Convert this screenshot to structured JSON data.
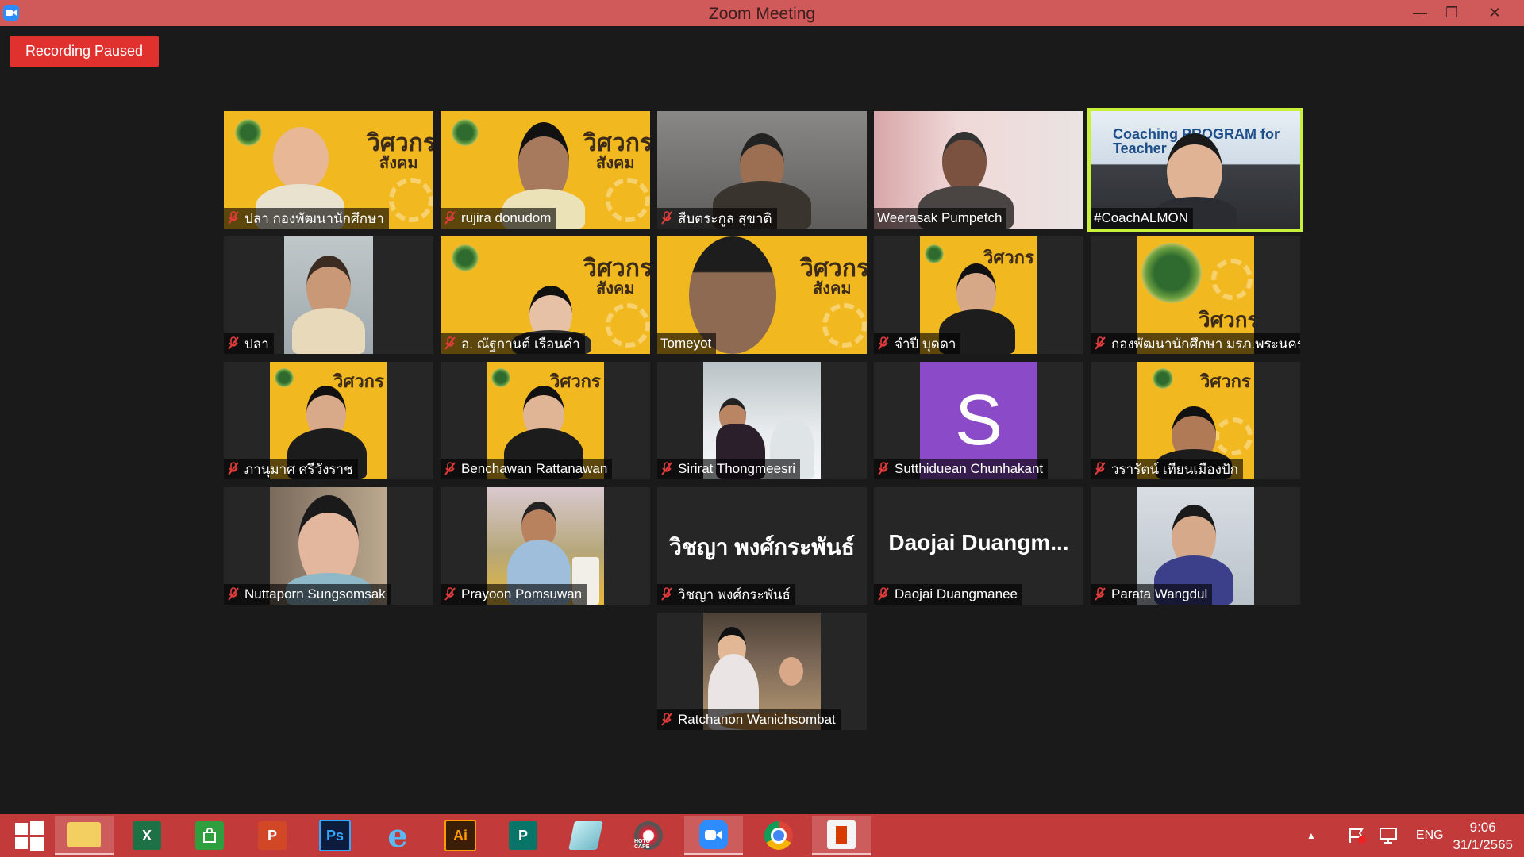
{
  "window": {
    "title": "Zoom Meeting",
    "minimize": "—",
    "restore": "❐",
    "close": "✕"
  },
  "recording": {
    "label": "Recording Paused"
  },
  "participants": [
    {
      "name": "ปลา กองพัฒนานักศึกษา",
      "muted": true,
      "active": false
    },
    {
      "name": "rujira donudom",
      "muted": true,
      "active": false
    },
    {
      "name": "สืบตระกูล สุขาติ",
      "muted": true,
      "active": false
    },
    {
      "name": "Weerasak Pumpetch",
      "muted": false,
      "active": false
    },
    {
      "name": "#CoachALMON",
      "muted": false,
      "active": true
    },
    {
      "name": "ปลา",
      "muted": true,
      "active": false
    },
    {
      "name": "อ. ณัฐกานต์ เรือนคำ",
      "muted": true,
      "active": false
    },
    {
      "name": "Tomeyot",
      "muted": false,
      "active": false
    },
    {
      "name": "จำปี บุดดา",
      "muted": true,
      "active": false
    },
    {
      "name": "กองพัฒนานักศึกษา มรภ.พระนคร",
      "muted": true,
      "active": false
    },
    {
      "name": "ภานุมาศ ศรีวังราช",
      "muted": true,
      "active": false
    },
    {
      "name": "Benchawan Rattanawan",
      "muted": true,
      "active": false
    },
    {
      "name": "Sirirat Thongmeesri",
      "muted": true,
      "active": false
    },
    {
      "name": "Sutthiduean Chunhakant",
      "muted": true,
      "active": false,
      "avatar_letter": "S"
    },
    {
      "name": "วรารัตน์ เทียนเมืองปัก",
      "muted": true,
      "active": false
    },
    {
      "name": "Nuttaporn Sungsomsak",
      "muted": true,
      "active": false
    },
    {
      "name": "Prayoon Pomsuwan",
      "muted": true,
      "active": false
    },
    {
      "name": "วิชญา พงศ์กระพันธ์",
      "muted": true,
      "active": false,
      "display_text": "วิชญา พงศ์กระพันธ์"
    },
    {
      "name": "Daojai Duangmanee",
      "muted": true,
      "active": false,
      "display_text": "Daojai  Duangm..."
    },
    {
      "name": "Parata Wangdul",
      "muted": true,
      "active": false
    },
    {
      "name": "Ratchanon Wanichsombat",
      "muted": true,
      "active": false
    }
  ],
  "backgrounds": {
    "sign_title": "วิศวกร",
    "sign_sub": "สังคม",
    "coach_sign": "Coaching PROGRAM for Teacher"
  },
  "taskbar": {
    "items": [
      {
        "name": "start-button",
        "label": ""
      },
      {
        "name": "file-explorer",
        "label": ""
      },
      {
        "name": "excel",
        "label": "X"
      },
      {
        "name": "store",
        "label": ""
      },
      {
        "name": "powerpoint",
        "label": "P"
      },
      {
        "name": "photoshop",
        "label": "Ps"
      },
      {
        "name": "internet-explorer",
        "label": "e"
      },
      {
        "name": "illustrator",
        "label": "Ai"
      },
      {
        "name": "publisher",
        "label": "P"
      },
      {
        "name": "notes",
        "label": ""
      },
      {
        "name": "hotocape",
        "label": "HOTO CAPE"
      },
      {
        "name": "zoom",
        "label": ""
      },
      {
        "name": "chrome",
        "label": ""
      },
      {
        "name": "office",
        "label": ""
      }
    ],
    "language": "ENG",
    "time": "9:06",
    "date": "31/1/2565"
  },
  "colors": {
    "titlebar": "#d05a5a",
    "taskbar": "#c23a3a",
    "recording": "#e0312f",
    "active_speaker": "#c9f13b",
    "mute_icon": "#e23b3b",
    "avatar_bg": "#8b4ac8",
    "sign_yellow": "#f2b81f"
  }
}
